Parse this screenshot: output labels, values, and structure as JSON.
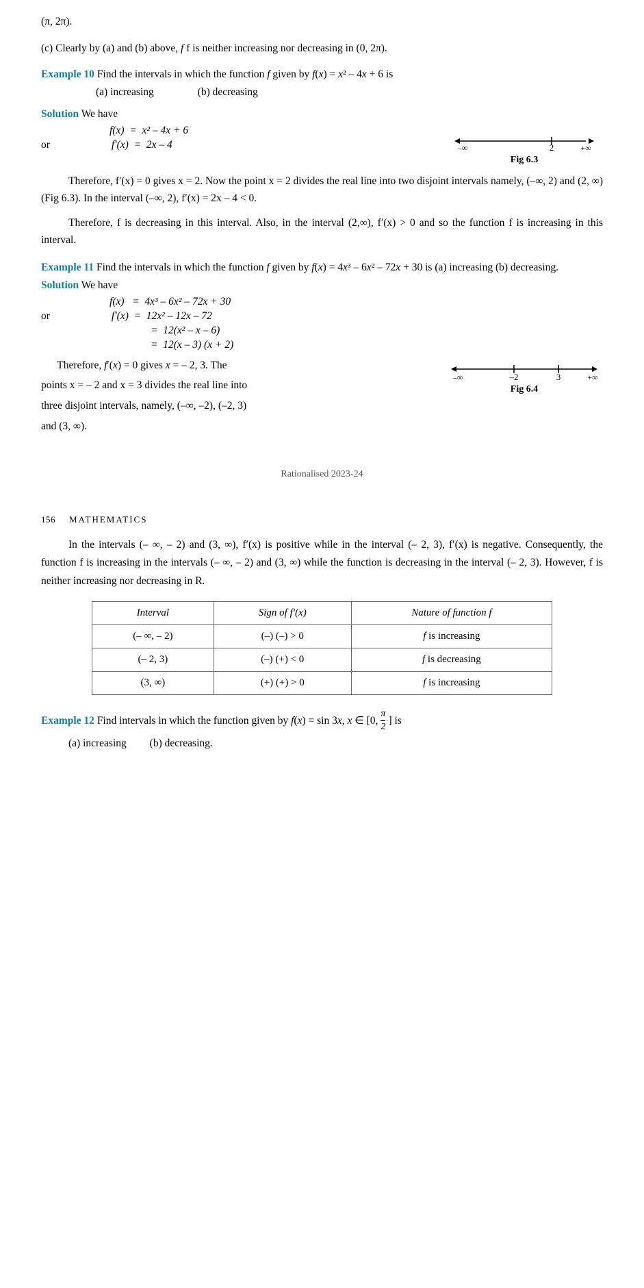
{
  "page": {
    "top_expression": "(π, 2π).",
    "part_c": "(c)   Clearly by (a) and (b) above,",
    "part_c_rest": "f is neither increasing nor decreasing in (0, 2π).",
    "example10": {
      "label": "Example 10",
      "text": "Find the intervals in which the function",
      "f_text": "f",
      "given_by": "given by",
      "fx_eq": "f(x) = x² – 4x + 6",
      "is_text": "is",
      "part_a": "(a) increasing",
      "part_b": "(b) decreasing"
    },
    "solution10": {
      "label": "Solution",
      "we_have": "We have",
      "fx_line": "f(x)  =  x² – 4x + 6",
      "or": "or",
      "fpx_line": "f′(x)  =  2x – 4",
      "fig_label": "Fig 6.3",
      "number_line": {
        "neg_inf": "–∞",
        "val1": "2",
        "pos_inf": "+∞"
      },
      "para1": "Therefore, f′(x) = 0 gives x = 2. Now the point x = 2 divides the real line into two disjoint intervals namely, (–∞, 2) and (2, ∞) (Fig 6.3). In the interval (–∞, 2), f′(x) = 2x – 4 < 0.",
      "para2": "Therefore, f is decreasing in this interval. Also, in the interval (2,∞),  f′(x) > 0 and so the function  f  is increasing in this interval."
    },
    "example11": {
      "label": "Example 11",
      "text": "Find the intervals in which the function",
      "f_text": "f",
      "given_by": "given by",
      "fx_eq": "f(x) = 4x³ – 6x² – 72x + 30",
      "is_text": "is (a) increasing (b) decreasing."
    },
    "solution11": {
      "label": "Solution",
      "we_have": "We have",
      "fx_line": "f(x)   =  4x³ – 6x² – 72x + 30",
      "or": "or",
      "fpx_line1": "f′(x)  =  12x² – 12x – 72",
      "fpx_line2": "=  12(x² – x – 6)",
      "fpx_line3": "=  12(x – 3) (x + 2)",
      "para_before_fig": "Therefore, f′(x) = 0 gives x = – 2, 3. The",
      "points_text": "points x = – 2 and x = 3 divides the real line into",
      "three_intervals": "three disjoint intervals, namely, (–∞, –2), (–2, 3)",
      "and_text": "and (3, ∞).",
      "fig_label": "Fig 6.4",
      "number_line": {
        "neg_inf": "–∞",
        "val1": "–2",
        "val2": "3",
        "pos_inf": "+∞"
      }
    },
    "rationalised": "Rationalised 2023-24",
    "page_number": "156",
    "page_subject": "MATHEMATICS",
    "page2_para1": "In the intervals (– ∞, – 2) and (3, ∞), f′(x) is positive while in the interval (– 2, 3), f′(x) is negative. Consequently, the function  f  is increasing in the intervals (– ∞, – 2) and (3, ∞) while the function is decreasing in the interval (– 2, 3). However, f is neither increasing nor decreasing in R.",
    "table": {
      "headers": [
        "Interval",
        "Sign of f′(x)",
        "Nature of function f"
      ],
      "rows": [
        [
          "(– ∞, – 2)",
          "(–) (–) > 0",
          "f is increasing"
        ],
        [
          "(– 2, 3)",
          "(–) (+) < 0",
          "f is decreasing"
        ],
        [
          "(3, ∞)",
          "(+) (+) > 0",
          "f is increasing"
        ]
      ]
    },
    "example12": {
      "label": "Example 12",
      "text": "Find intervals in which the function given by",
      "fx_eq": "f(x) = sin 3x,  x ∈ [0, π/2]",
      "is_text": "is",
      "part_a": "(a) increasing",
      "part_b": "(b) decreasing."
    }
  }
}
